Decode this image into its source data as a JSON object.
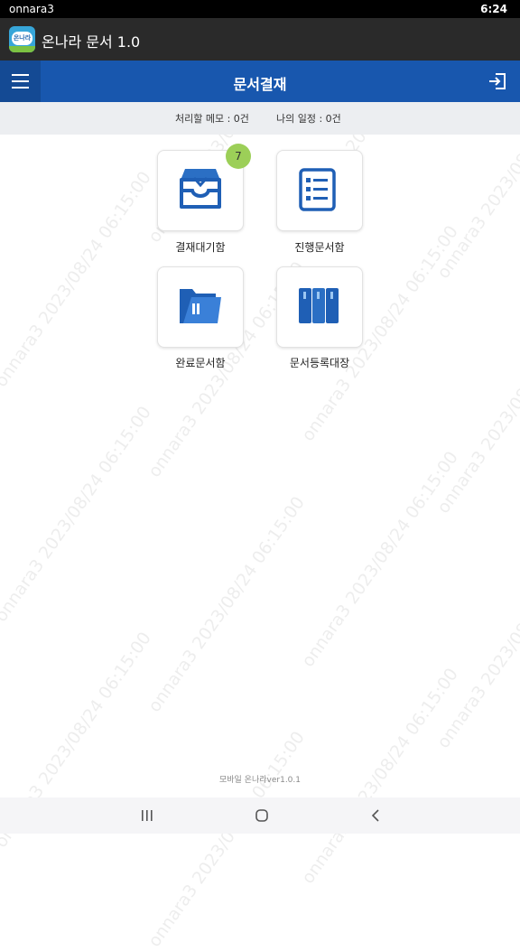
{
  "status_bar": {
    "carrier": "onnara3",
    "time": "6:24"
  },
  "app_bar": {
    "title": "온나라 문서 1.0",
    "icon_text": "온나라"
  },
  "header": {
    "title": "문서결재",
    "menu_icon": "hamburger-icon",
    "logout_icon": "logout-icon"
  },
  "info": {
    "memo": "처리할 메모 : 0건",
    "schedule": "나의 일정 : 0건"
  },
  "tiles": [
    {
      "label": "결재대기함",
      "icon": "inbox-tray-icon",
      "badge": "7"
    },
    {
      "label": "진행문서함",
      "icon": "list-document-icon"
    },
    {
      "label": "완료문서함",
      "icon": "folder-icon"
    },
    {
      "label": "문서등록대장",
      "icon": "binders-icon"
    }
  ],
  "watermark": "onnara3 2023/08/24 06:15:00",
  "footer": "모바일 온나라ver1.0.1",
  "nav": {
    "recent_icon": "recent-apps-icon",
    "home_icon": "home-icon",
    "back_icon": "back-icon"
  },
  "colors": {
    "header": "#1857ae",
    "app_bar": "#2a2a2a",
    "badge": "#9ccf58",
    "icon_blue": "#1f5fb5"
  }
}
